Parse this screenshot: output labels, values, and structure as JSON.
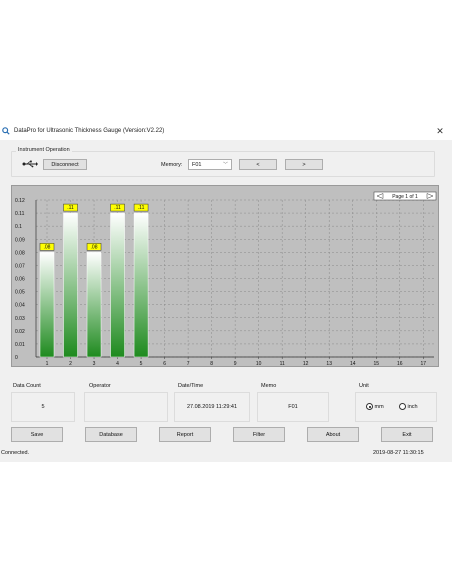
{
  "window": {
    "title": "DataPro for Ultrasonic Thickness Gauge (Version:V2.22)",
    "close_glyph": "✕"
  },
  "instrument": {
    "group_label": "Instrument Operation",
    "disconnect_label": "Disconnect",
    "memory_label": "Memory:",
    "memory_value": "F01",
    "prev_label": "<",
    "next_label": ">"
  },
  "chart": {
    "page_label": "Page 1 of 1",
    "colors": {
      "background": "#bfbfbf",
      "bar_top": "#ffffff",
      "bar_bottom": "#1e8a1e",
      "label_bg": "#ffff00"
    }
  },
  "chart_data": {
    "type": "bar",
    "categories": [
      "1",
      "2",
      "3",
      "4",
      "5",
      "6",
      "7",
      "8",
      "9",
      "10",
      "11",
      "12",
      "13",
      "14",
      "15",
      "16",
      "17"
    ],
    "values": [
      0.08,
      0.11,
      0.08,
      0.11,
      0.11
    ],
    "data_labels": [
      ".08",
      ".11",
      ".08",
      ".11",
      ".11"
    ],
    "yticks": [
      "0",
      "0.01",
      "0.02",
      "0.03",
      "0.04",
      "0.05",
      "0.06",
      "0.07",
      "0.08",
      "0.09",
      "0.1",
      "0.11",
      "0.12"
    ],
    "ylim": [
      0,
      0.12
    ],
    "grid": true,
    "title": "",
    "xlabel": "",
    "ylabel": ""
  },
  "info": {
    "data_count_label": "Data Count",
    "data_count_value": "5",
    "operator_label": "Operator",
    "operator_value": "",
    "datetime_label": "Date/Time",
    "datetime_value": "27.08.2019 11:29:41",
    "memo_label": "Memo",
    "memo_value": "F01",
    "unit_label": "Unit",
    "unit_mm": "mm",
    "unit_inch": "inch",
    "unit_selected": "mm"
  },
  "buttons": {
    "save": "Save",
    "database": "Database",
    "report": "Report",
    "filter": "Filter",
    "about": "About",
    "exit": "Exit"
  },
  "status": {
    "left": "Connected.",
    "right": "2019-08-27 11:30:15"
  }
}
